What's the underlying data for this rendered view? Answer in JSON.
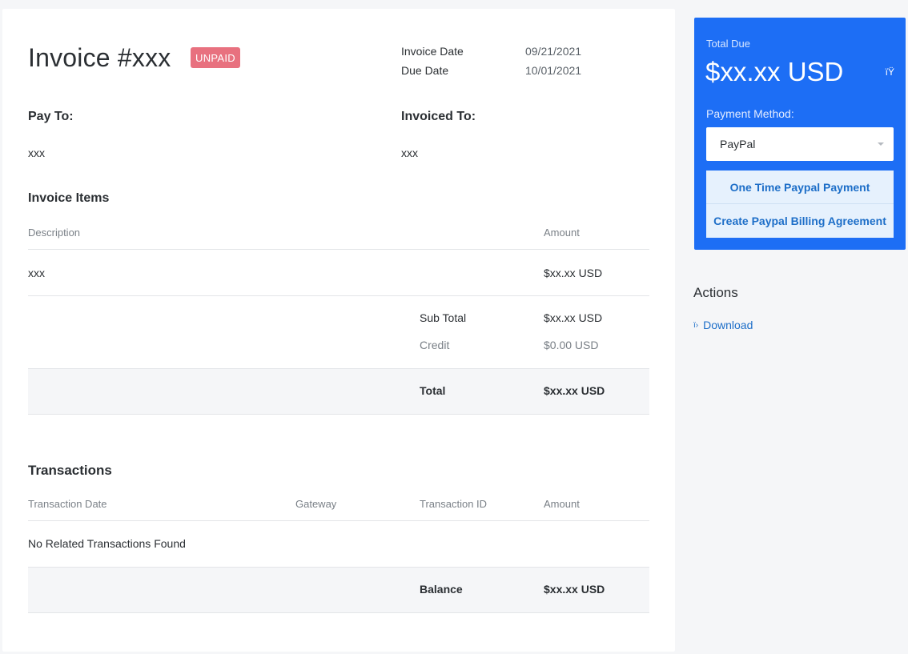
{
  "invoice": {
    "title": "Invoice #xxx",
    "status_badge": "UNPAID",
    "invoice_date_label": "Invoice Date",
    "invoice_date": "09/21/2021",
    "due_date_label": "Due Date",
    "due_date": "10/01/2021"
  },
  "parties": {
    "pay_to_label": "Pay To:",
    "pay_to_value": "xxx",
    "invoiced_to_label": "Invoiced To:",
    "invoiced_to_value": "xxx"
  },
  "items": {
    "heading": "Invoice Items",
    "col_description": "Description",
    "col_amount": "Amount",
    "rows": [
      {
        "description": "xxx",
        "amount": "$xx.xx USD"
      }
    ],
    "subtotal_label": "Sub Total",
    "subtotal_value": "$xx.xx USD",
    "credit_label": "Credit",
    "credit_value": "$0.00 USD",
    "total_label": "Total",
    "total_value": "$xx.xx USD"
  },
  "transactions": {
    "heading": "Transactions",
    "col_date": "Transaction Date",
    "col_gateway": "Gateway",
    "col_id": "Transaction ID",
    "col_amount": "Amount",
    "empty_message": "No Related Transactions Found",
    "balance_label": "Balance",
    "balance_value": "$xx.xx USD"
  },
  "payment_panel": {
    "total_due_label": "Total Due",
    "total_due_amount": "$xx.xx USD",
    "icon_glyph": "ïŸ",
    "payment_method_label": "Payment Method:",
    "payment_method_selected": "PayPal",
    "one_time_button": "One Time Paypal Payment",
    "billing_agreement_button": "Create Paypal Billing Agreement"
  },
  "actions": {
    "heading": "Actions",
    "download_icon_glyph": "ï›",
    "download_label": "Download"
  },
  "colors": {
    "accent_blue": "#1d6ef5",
    "unpaid_badge": "#e8717f",
    "link_blue": "#1d6ec8",
    "page_bg": "#f5f6f8"
  }
}
